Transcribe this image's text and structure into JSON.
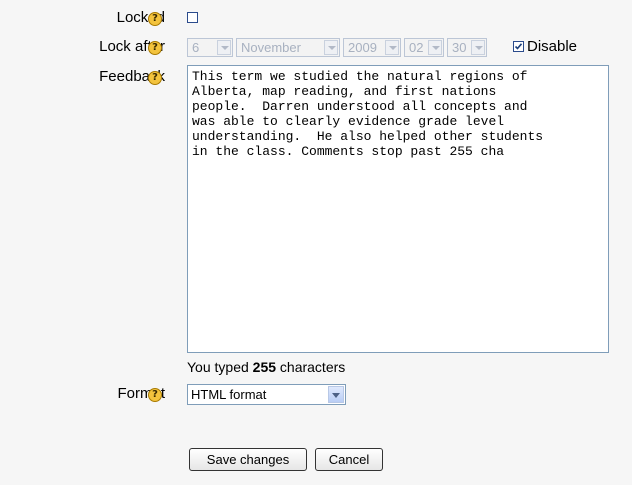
{
  "locked": {
    "label": "Locked",
    "checked": false
  },
  "lock_after": {
    "label": "Lock after",
    "day": "6",
    "month": "November",
    "year": "2009",
    "hour": "02",
    "minute": "30",
    "disable_label": "Disable",
    "disable_checked": true
  },
  "feedback": {
    "label": "Feedback",
    "text": "This term we studied the natural regions of\nAlberta, map reading, and first nations\npeople.  Darren understood all concepts and\nwas able to clearly evidence grade level\nunderstanding.  He also helped other students\nin the class. Comments stop past 255 cha"
  },
  "counter": {
    "prefix": "You typed ",
    "count": "255",
    "suffix": " characters"
  },
  "format": {
    "label": "Format",
    "value": "HTML format"
  },
  "buttons": {
    "save": "Save changes",
    "cancel": "Cancel"
  },
  "help_glyph": "?",
  "colors": {
    "help_icon": "#f3c33d",
    "background": "#f6f6f6"
  }
}
